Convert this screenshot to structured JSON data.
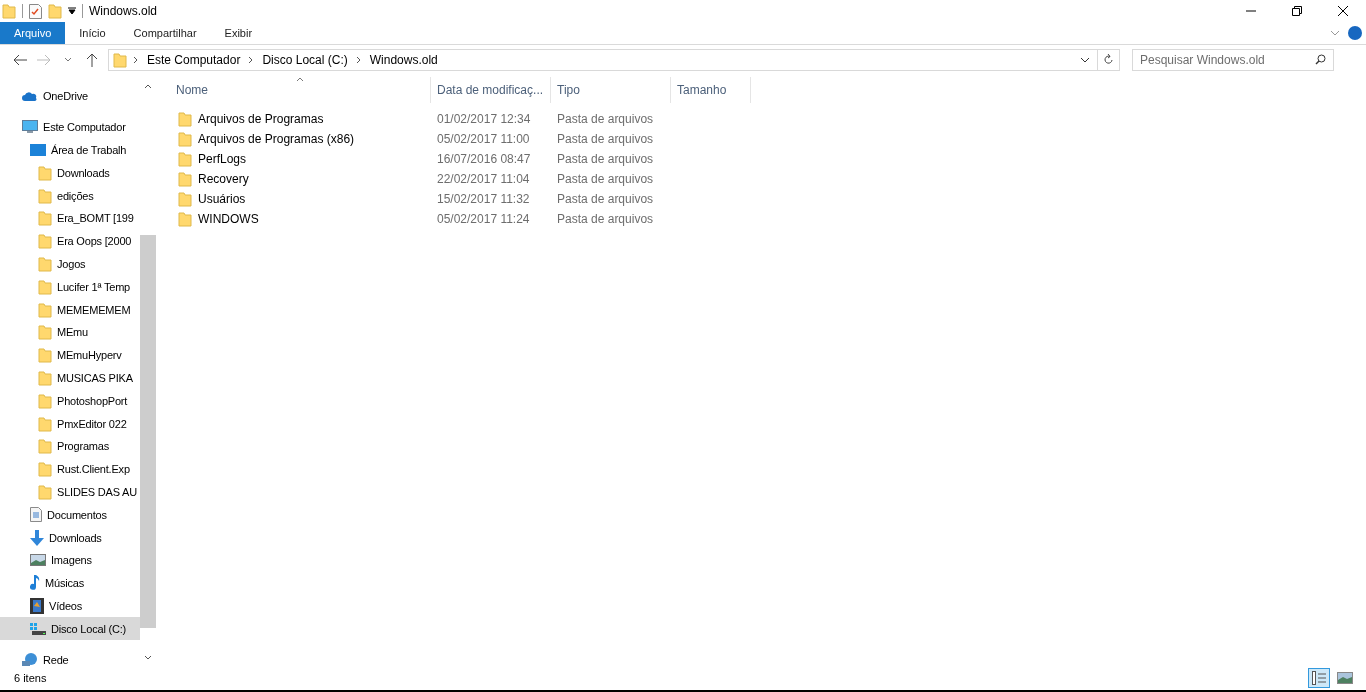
{
  "window": {
    "title": "Windows.old"
  },
  "ribbon_tabs": [
    {
      "label": "Arquivo",
      "selected": true
    },
    {
      "label": "Início",
      "selected": false
    },
    {
      "label": "Compartilhar",
      "selected": false
    },
    {
      "label": "Exibir",
      "selected": false
    }
  ],
  "address": {
    "crumbs": [
      "Este Computador",
      "Disco Local (C:)",
      "Windows.old"
    ]
  },
  "search": {
    "placeholder": "Pesquisar Windows.old"
  },
  "sidebar": {
    "items": [
      {
        "label": "OneDrive",
        "kind": "cloud",
        "selected": false
      },
      {
        "label": "Este Computador",
        "kind": "computer",
        "selected": false,
        "children": [
          {
            "label": "Área de Trabalh",
            "kind": "desktop",
            "selected": false,
            "children": [
              {
                "label": "Downloads",
                "kind": "folder",
                "selected": false
              },
              {
                "label": "edições",
                "kind": "folder",
                "selected": false
              },
              {
                "label": "Era_BOMT [199",
                "kind": "folder",
                "selected": false
              },
              {
                "label": "Era Oops [2000",
                "kind": "folder",
                "selected": false
              },
              {
                "label": "Jogos",
                "kind": "folder",
                "selected": false
              },
              {
                "label": "Lucifer 1ª Temp",
                "kind": "folder",
                "selected": false
              },
              {
                "label": "MEMEMEMEM",
                "kind": "folder",
                "selected": false
              },
              {
                "label": "MEmu",
                "kind": "folder",
                "selected": false
              },
              {
                "label": "MEmuHyperv",
                "kind": "folder",
                "selected": false
              },
              {
                "label": "MUSICAS PIKA",
                "kind": "folder",
                "selected": false
              },
              {
                "label": "PhotoshopPort",
                "kind": "folder",
                "selected": false
              },
              {
                "label": "PmxEditor 022",
                "kind": "folder",
                "selected": false
              },
              {
                "label": "Programas",
                "kind": "folder",
                "selected": false
              },
              {
                "label": "Rust.Client.Exp",
                "kind": "folder",
                "selected": false
              },
              {
                "label": "SLIDES DAS AU",
                "kind": "folder",
                "selected": false
              }
            ]
          },
          {
            "label": "Documentos",
            "kind": "document",
            "selected": false
          },
          {
            "label": "Downloads",
            "kind": "download",
            "selected": false
          },
          {
            "label": "Imagens",
            "kind": "image",
            "selected": false
          },
          {
            "label": "Músicas",
            "kind": "music",
            "selected": false
          },
          {
            "label": "Vídeos",
            "kind": "video",
            "selected": false
          },
          {
            "label": "Disco Local (C:)",
            "kind": "drive",
            "selected": true
          }
        ]
      },
      {
        "label": "Rede",
        "kind": "network",
        "selected": false
      }
    ]
  },
  "table": {
    "columns": [
      "Nome",
      "Data de modificaç...",
      "Tipo",
      "Tamanho"
    ],
    "rows": [
      {
        "name": "Arquivos de Programas",
        "date": "01/02/2017 12:34",
        "type": "Pasta de arquivos"
      },
      {
        "name": "Arquivos de Programas (x86)",
        "date": "05/02/2017 11:00",
        "type": "Pasta de arquivos"
      },
      {
        "name": "PerfLogs",
        "date": "16/07/2016 08:47",
        "type": "Pasta de arquivos"
      },
      {
        "name": "Recovery",
        "date": "22/02/2017 11:04",
        "type": "Pasta de arquivos"
      },
      {
        "name": "Usuários",
        "date": "15/02/2017 11:32",
        "type": "Pasta de arquivos"
      },
      {
        "name": "WINDOWS",
        "date": "05/02/2017 11:24",
        "type": "Pasta de arquivos"
      }
    ]
  },
  "status_bar": {
    "count": "6 itens",
    "view_modes": [
      {
        "kind": "details",
        "selected": true
      },
      {
        "kind": "thumbnails",
        "selected": false
      }
    ]
  }
}
